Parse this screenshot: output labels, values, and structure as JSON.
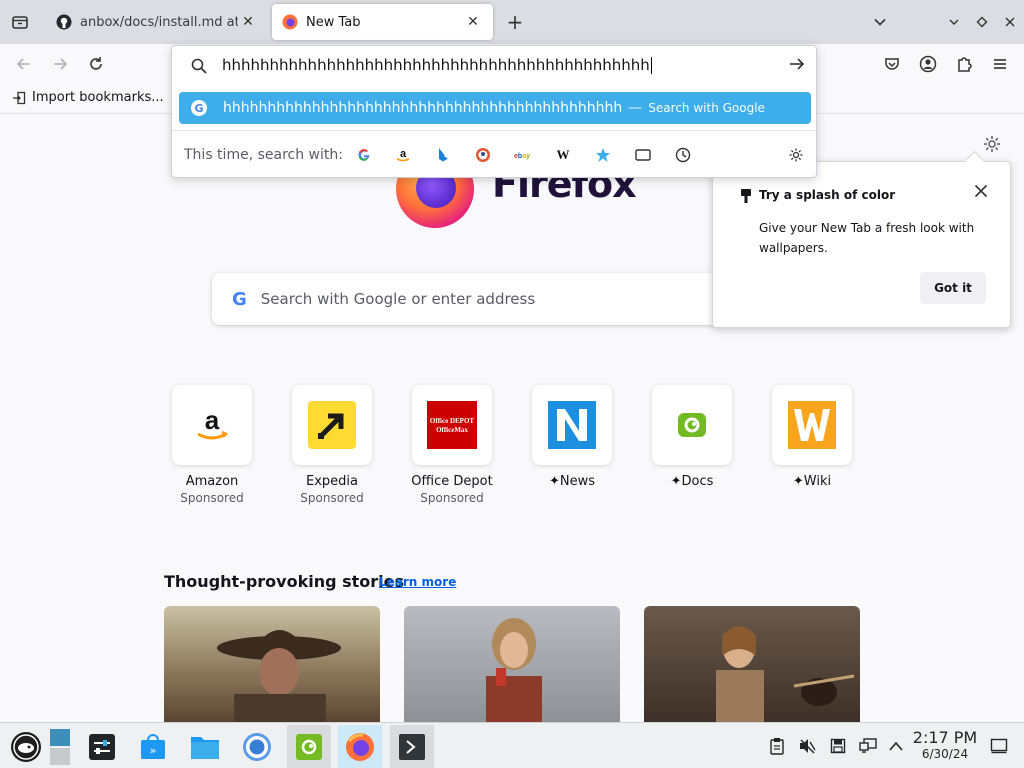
{
  "tabs": [
    {
      "title": "anbox/docs/install.md at m",
      "icon": "github-icon",
      "active": false
    },
    {
      "title": "New Tab",
      "icon": "firefox-icon",
      "active": true
    }
  ],
  "bookmarks": {
    "import_label": "Import bookmarks..."
  },
  "urlbar": {
    "value": "hhhhhhhhhhhhhhhhhhhhhhhhhhhhhhhhhhhhhhhhhhhhh",
    "suggestion": {
      "text": "hhhhhhhhhhhhhhhhhhhhhhhhhhhhhhhhhhhhhhhhhhhhh",
      "separator": "—",
      "action": "Search with Google"
    },
    "engines_label": "This time, search with:",
    "engines": [
      "google",
      "amazon",
      "bing",
      "duckduckgo",
      "ebay",
      "wikipedia",
      "bookmarks",
      "tabs",
      "history"
    ]
  },
  "newtab": {
    "logo_text": "Firefox",
    "search_placeholder": "Search with Google or enter address",
    "tiles": [
      {
        "name": "Amazon",
        "sponsored": "Sponsored",
        "pinned": false
      },
      {
        "name": "Expedia",
        "sponsored": "Sponsored",
        "pinned": false
      },
      {
        "name": "Office Depot",
        "sponsored": "Sponsored",
        "pinned": false
      },
      {
        "name": "News",
        "sponsored": "",
        "pinned": true
      },
      {
        "name": "Docs",
        "sponsored": "",
        "pinned": true
      },
      {
        "name": "Wiki",
        "sponsored": "",
        "pinned": true
      }
    ],
    "office_depot_logo_text": "Office DEPOT OfficeMax",
    "stories_title": "Thought-provoking stories",
    "learn_more": "Learn more"
  },
  "popup": {
    "title": "Try a splash of color",
    "body": "Give your New Tab a fresh look with wallpapers.",
    "button": "Got it"
  },
  "taskbar": {
    "time": "2:17 PM",
    "date": "6/30/24"
  },
  "colors": {
    "accent": "#3daee9",
    "link": "#0061e0"
  }
}
